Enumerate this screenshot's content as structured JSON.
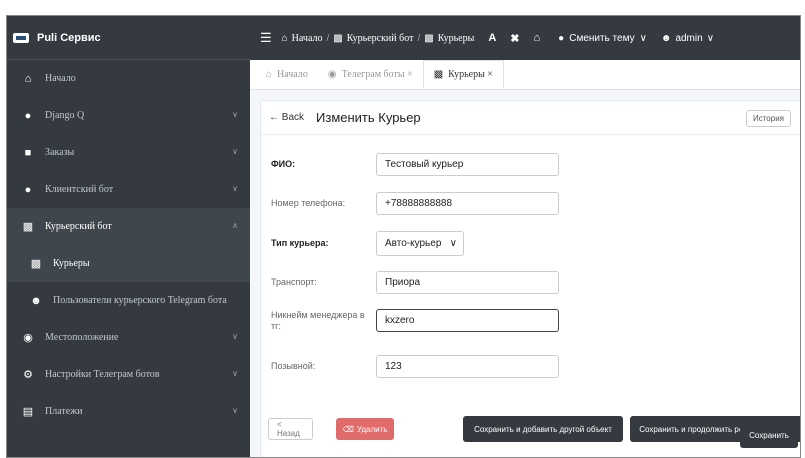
{
  "sidebar": {
    "brand": "Puli Сервис",
    "items": [
      {
        "label": "Начало",
        "icon": "home-icon"
      },
      {
        "label": "Django Q",
        "icon": "users-icon"
      },
      {
        "label": "Заказы",
        "icon": "gift-icon"
      },
      {
        "label": "Клиентский бот",
        "icon": "chat-icon"
      },
      {
        "label": "Курьерский бот",
        "icon": "truck-icon"
      },
      {
        "label": "Курьеры",
        "icon": "truck-icon"
      },
      {
        "label": "Пользователи курьерского Telegram бота",
        "icon": "people-icon"
      },
      {
        "label": "Местоположение",
        "icon": "compass-icon"
      },
      {
        "label": "Настройки Телеграм ботов",
        "icon": "gear-icon"
      },
      {
        "label": "Платежи",
        "icon": "document-icon"
      }
    ]
  },
  "topbar": {
    "breadcrumb": [
      "Начало",
      "Курьерский бот",
      "Курьеры"
    ],
    "theme_label": "Сменить тему",
    "user": "admin",
    "font_button": "A"
  },
  "tabs": [
    {
      "label": "Начало"
    },
    {
      "label": "Телеграм боты ×"
    },
    {
      "label": "Курьеры ×"
    }
  ],
  "form": {
    "back": "← Back",
    "title": "Изменить Курьер",
    "history": "История",
    "fields": [
      {
        "label": "ФИО:",
        "value": "Тестовый курьер"
      },
      {
        "label": "Номер телефона:",
        "value": "+78888888888"
      },
      {
        "label": "Тип курьера:",
        "value": "Авто-курьер"
      },
      {
        "label": "Транспорт:",
        "value": "Приора"
      },
      {
        "label": "Никнейм менеджера в тг:",
        "value": "kxzero"
      },
      {
        "label": "Позывной:",
        "value": "123"
      }
    ],
    "buttons": {
      "back": "< Назад",
      "delete": "Удалить",
      "save_add": "Сохранить и добавить другой объект",
      "save_continue": "Сохранить и продолжить редактирование",
      "save": "Сохранить"
    }
  }
}
